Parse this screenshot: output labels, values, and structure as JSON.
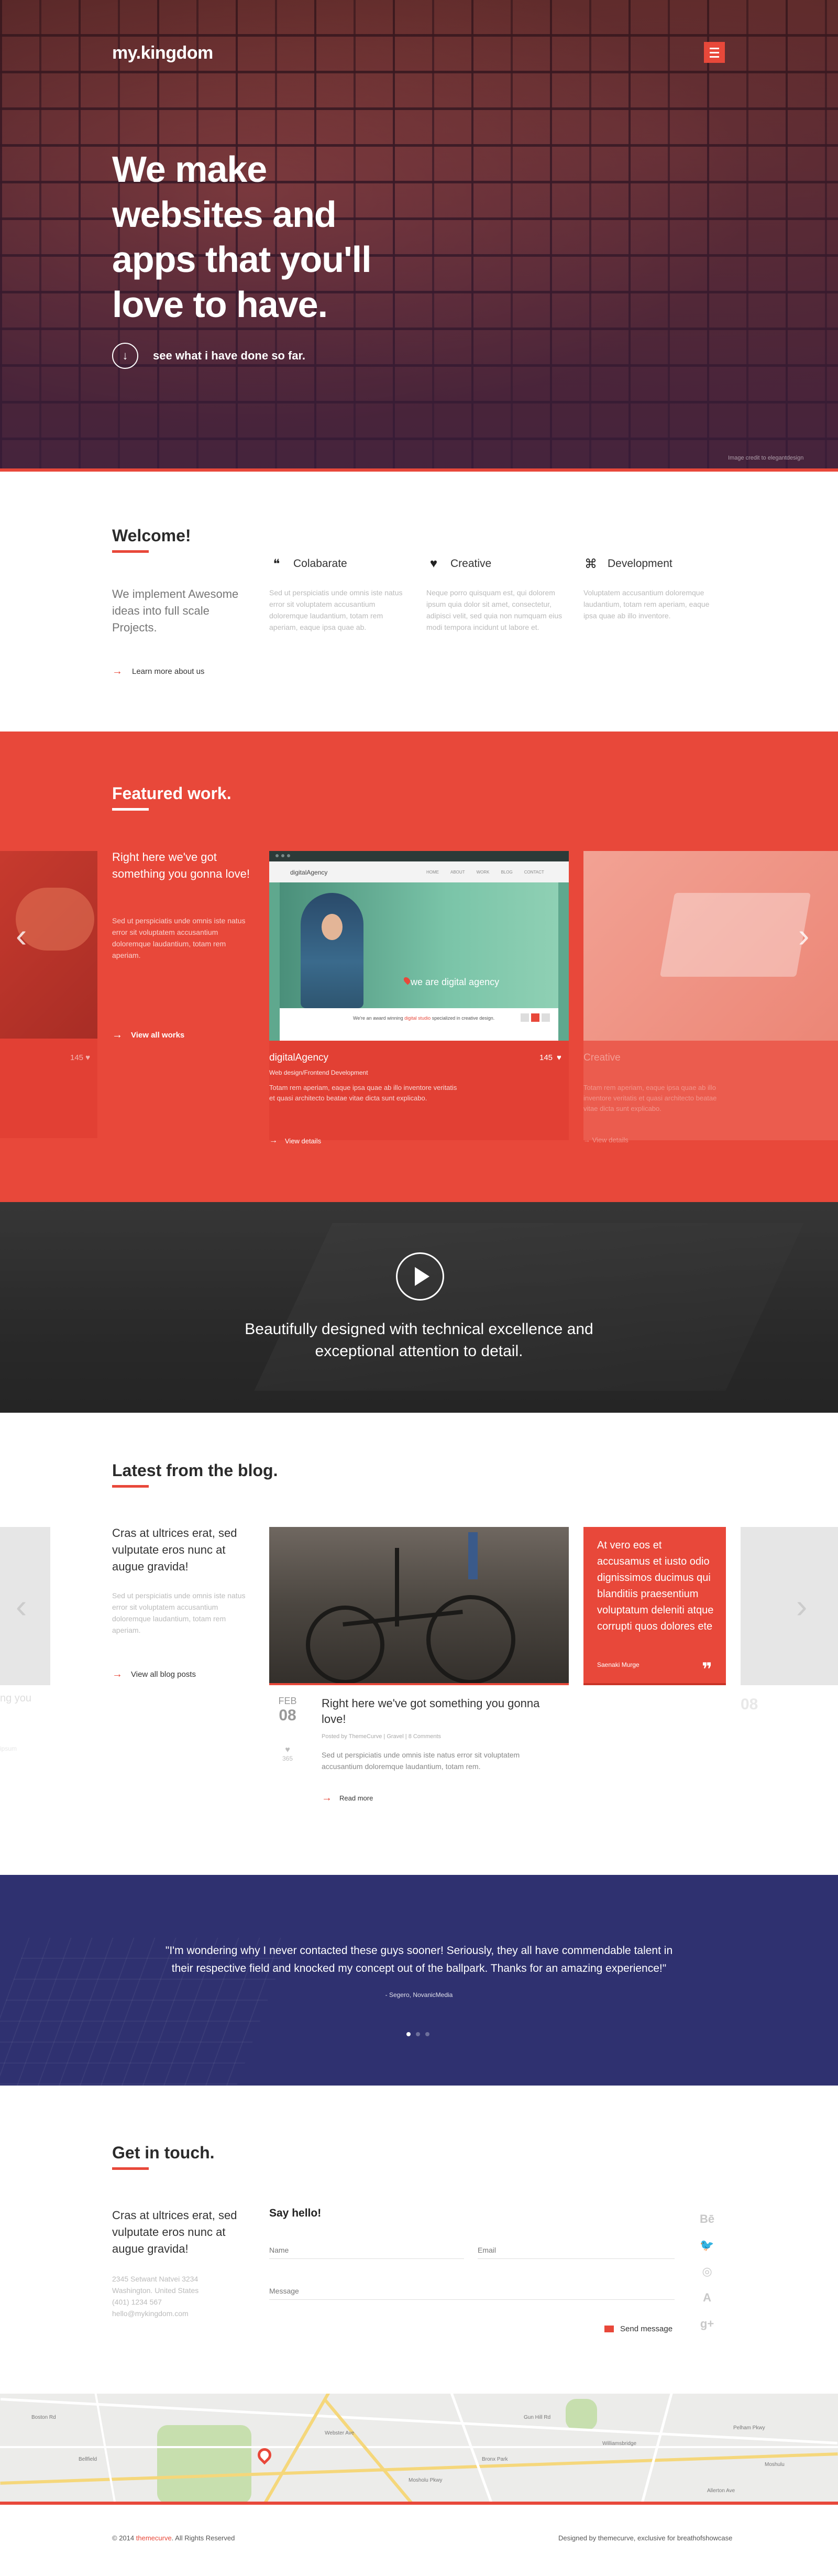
{
  "brand": {
    "logo": "my.kingdom",
    "accent": "#e8483a"
  },
  "hero": {
    "title": "We make websites and apps that you'll love to have.",
    "cta": "see what i have done so far.",
    "credit": "Image credit to elegantdesign"
  },
  "welcome": {
    "title": "Welcome!",
    "intro": "We implement Awesome ideas into full scale Projects.",
    "link": "Learn more about us",
    "services": [
      {
        "icon": "chat-icon",
        "title": "Colabarate",
        "text": "Sed ut perspiciatis unde omnis iste natus error sit voluptatem accusantium doloremque laudantium, totam rem aperiam, eaque ipsa quae ab."
      },
      {
        "icon": "heart-icon",
        "title": "Creative",
        "text": "Neque porro quisquam est, qui dolorem ipsum quia dolor sit amet, consectetur, adipisci velit, sed quia non numquam eius modi tempora incidunt ut labore et."
      },
      {
        "icon": "command-icon",
        "title": "Development",
        "text": "Voluptatem accusantium doloremque laudantium, totam rem aperiam, eaque ipsa quae ab illo inventore."
      }
    ]
  },
  "featured": {
    "title": "Featured work.",
    "intro": "Right here we've got something you gonna love!",
    "intro_sub": "Sed ut perspiciatis unde omnis iste natus error sit voluptatem accusantium doloremque laudantium, totam rem aperiam.",
    "view_all": "View all works",
    "left_likes": "145",
    "card": {
      "mock_brand": "digitalAgency",
      "mock_nav": [
        "HOME",
        "ABOUT",
        "WORK",
        "BLOG",
        "CONTACT"
      ],
      "mock_headline": "we are digital agency",
      "mock_foot_pre": "We're an award winning",
      "mock_foot_accent": "digital studio",
      "mock_foot_post": "specialized in creative design.",
      "name": "digitalAgency",
      "likes": "145",
      "category": "Web design/Frontend Development",
      "desc": "Totam rem aperiam, eaque ipsa quae ab illo inventore veritatis et quasi architecto beatae vitae dicta sunt explicabo.",
      "details": "View details"
    },
    "right": {
      "name": "Creative",
      "desc": "Totam rem aperiam, eaque ipsa quae ab illo inventore veritatis et quasi architecto beatae vitae dicta sunt explicabo.",
      "details": "View details"
    }
  },
  "video": {
    "text": "Beautifully designed with technical excellence and exceptional attention to detail."
  },
  "blog": {
    "title": "Latest from the blog.",
    "intro": "Cras at ultrices erat, sed vulputate eros nunc at augue gravida!",
    "intro_sub": "Sed ut perspiciatis unde omnis iste natus error sit voluptatem accusantium doloremque laudantium, totam rem aperiam.",
    "view_posts": "View all blog posts",
    "left_partial": "ng you",
    "left_partial2": "ipsum",
    "post": {
      "month": "FEB",
      "day": "08",
      "likes": "365",
      "title": "Right here we've got something you gonna love!",
      "byline": "Posted by ThemeCurve | Gravel | 8 Comments",
      "body": "Sed ut perspiciatis unde omnis iste natus error sit voluptatem accusantium doloremque laudantium, totam rem.",
      "more": "Read more"
    },
    "quote": {
      "text": "At vero eos et accusamus et iusto odio dignissimos ducimus qui blanditiis praesentium voluptatum deleniti atque corrupti quos dolores ete",
      "author": "Saenaki Murge"
    },
    "right_partial_day": "08"
  },
  "testimonial": {
    "text": "\"I'm wondering why I never contacted these guys sooner! Seriously, they all have commendable talent in their respective field and knocked my concept out of the ballpark. Thanks for an amazing experience!\"",
    "author": "- Segero, NovanicMedia",
    "dots": 3,
    "active_dot": 0
  },
  "contact": {
    "title": "Get in touch.",
    "intro": "Cras at ultrices erat, sed vulputate eros nunc at augue gravida!",
    "address_lines": [
      "2345 Setwant Natvei 3234",
      "Washington. United States",
      "(401) 1234 567",
      "hello@mykingdom.com"
    ],
    "say_hello": "Say hello!",
    "name_ph": "Name",
    "email_ph": "Email",
    "message_ph": "Message",
    "send": "Send message",
    "social": [
      "behance-icon",
      "twitter-icon",
      "dribbble-icon",
      "deviantart-icon",
      "googleplus-icon"
    ],
    "social_glyphs": [
      "Bē",
      "🐦",
      "◎",
      "A",
      "g+"
    ]
  },
  "map": {
    "labels": [
      "Bellfield",
      "Webster Ave",
      "Mosholu Pkwy",
      "Gun Hill Rd",
      "Williamsbridge",
      "Allerton Ave",
      "Bronx Park",
      "Pelham Pkwy",
      "Moshulu",
      "Boston Rd"
    ]
  },
  "footer": {
    "left_pre": "© 2014",
    "left_accent": "themecurve",
    "left_post": ". All Rights Reserved",
    "right": "Designed by themecurve, exclusive for breathofshowcase"
  }
}
